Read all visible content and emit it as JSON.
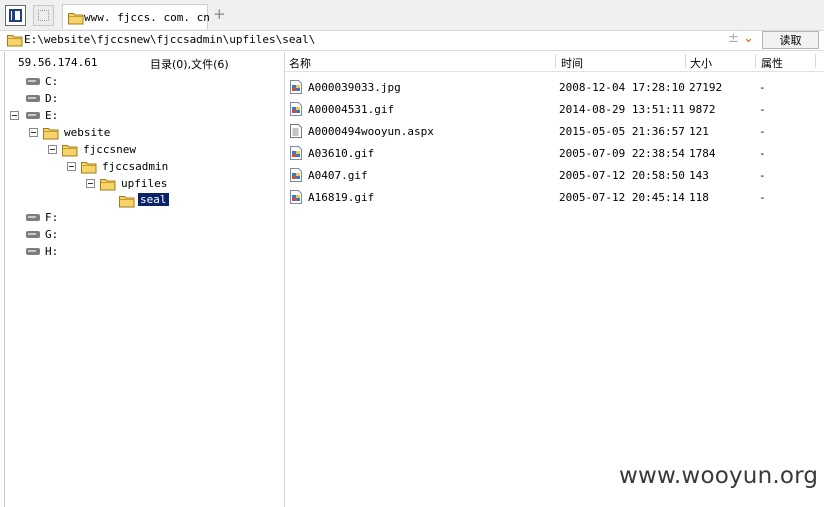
{
  "tabbar": {
    "tab_title": "www. fjccs. com. cn",
    "add_label": "+"
  },
  "address": {
    "path": "E:\\website\\fjccsnew\\fjccsadmin\\upfiles\\seal\\",
    "separator": "±",
    "chevron": "⌄",
    "read_button": "读取"
  },
  "left": {
    "ip": "59.56.174.61",
    "counts": "目录(0),文件(6)",
    "tree": [
      {
        "label": "C:",
        "type": "drive"
      },
      {
        "label": "D:",
        "type": "drive"
      },
      {
        "label": "E:",
        "type": "drive",
        "expanded": true
      },
      {
        "label": "website",
        "type": "folder"
      },
      {
        "label": "fjccsnew",
        "type": "folder"
      },
      {
        "label": "fjccsadmin",
        "type": "folder"
      },
      {
        "label": "upfiles",
        "type": "folder"
      },
      {
        "label": "seal",
        "type": "folder",
        "selected": true
      },
      {
        "label": "F:",
        "type": "drive"
      },
      {
        "label": "G:",
        "type": "drive"
      },
      {
        "label": "H:",
        "type": "drive"
      }
    ]
  },
  "files": {
    "columns": {
      "name": "名称",
      "time": "时间",
      "size": "大小",
      "attr": "属性"
    },
    "rows": [
      {
        "name": "A000039033.jpg",
        "time": "2008-12-04 17:28:10",
        "size": "27192",
        "attr": "-",
        "icon": "image-file-icon"
      },
      {
        "name": "A00004531.gif",
        "time": "2014-08-29 13:51:11",
        "size": "9872",
        "attr": "-",
        "icon": "image-file-icon"
      },
      {
        "name": "A0000494wooyun.aspx",
        "time": "2015-05-05 21:36:57",
        "size": "121",
        "attr": "-",
        "icon": "text-file-icon"
      },
      {
        "name": "A03610.gif",
        "time": "2005-07-09 22:38:54",
        "size": "1784",
        "attr": "-",
        "icon": "image-file-icon"
      },
      {
        "name": "A0407.gif",
        "time": "2005-07-12 20:58:50",
        "size": "143",
        "attr": "-",
        "icon": "image-file-icon"
      },
      {
        "name": "A16819.gif",
        "time": "2005-07-12 20:45:14",
        "size": "118",
        "attr": "-",
        "icon": "image-file-icon"
      }
    ]
  },
  "watermark": "www.wooyun.org",
  "colors": {
    "folder": "#f3c94c",
    "selection": "#0a246a",
    "accent": "#e05a2a"
  }
}
